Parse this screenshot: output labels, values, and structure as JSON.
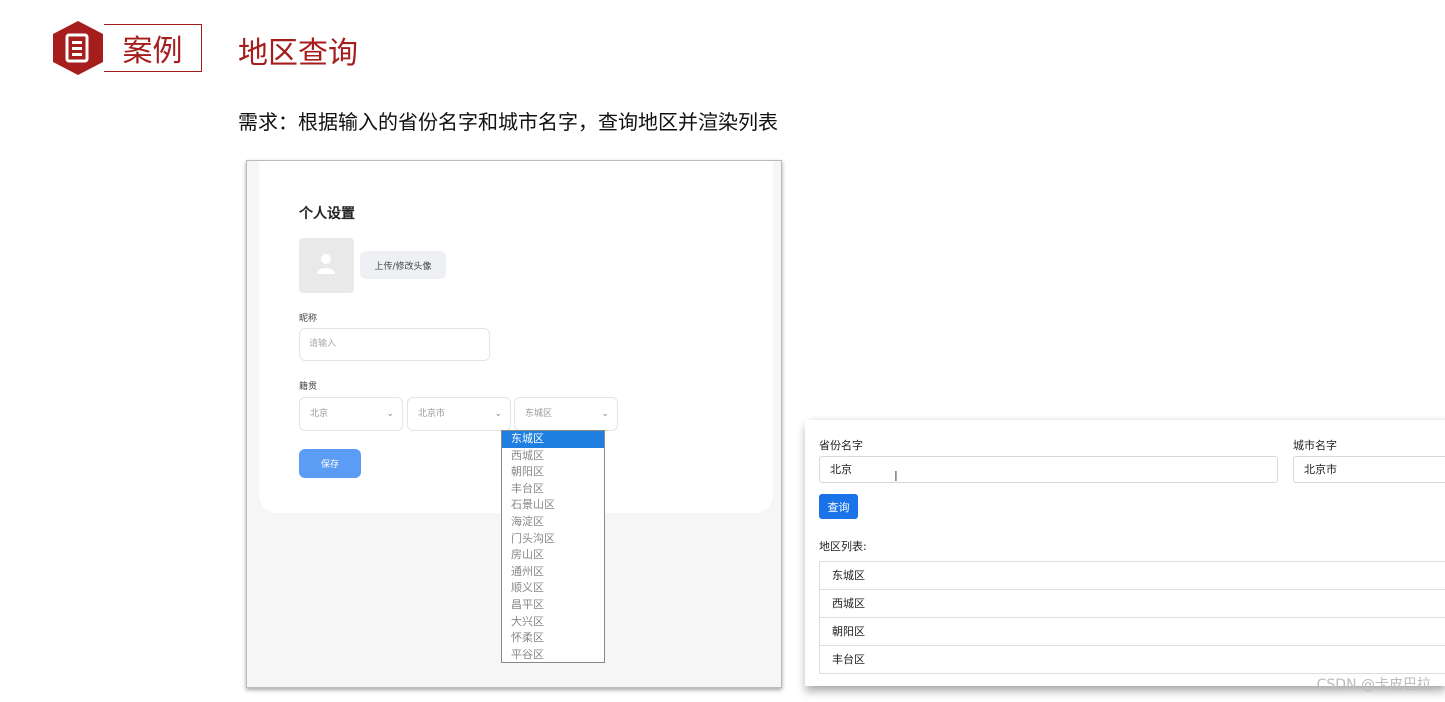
{
  "header": {
    "tag_label": "案例",
    "title": "地区查询"
  },
  "requirement": "需求：根据输入的省份名字和城市名字，查询地区并渲染列表",
  "settings_form": {
    "title": "个人设置",
    "upload_button": "上传/修改头像",
    "nickname_label": "昵称",
    "nickname_placeholder": "请输入",
    "hometown_label": "籍贯",
    "province_select": "北京",
    "city_select": "北京市",
    "district_select": "东城区",
    "save_button": "保存",
    "district_options": [
      "东城区",
      "西城区",
      "朝阳区",
      "丰台区",
      "石景山区",
      "海淀区",
      "门头沟区",
      "房山区",
      "通州区",
      "顺义区",
      "昌平区",
      "大兴区",
      "怀柔区",
      "平谷区"
    ],
    "selected_option": "东城区"
  },
  "query_form": {
    "province_label": "省份名字",
    "province_value": "北京",
    "city_label": "城市名字",
    "city_value": "北京市",
    "query_button": "查询",
    "list_label": "地区列表:",
    "regions": [
      "东城区",
      "西城区",
      "朝阳区",
      "丰台区"
    ]
  },
  "watermark": "CSDN @卡皮巴拉",
  "colors": {
    "brand_red": "#a61d1d",
    "save_blue": "#5b9cf5",
    "query_blue": "#1a73e8",
    "dropdown_highlight": "#1e7fe0"
  }
}
